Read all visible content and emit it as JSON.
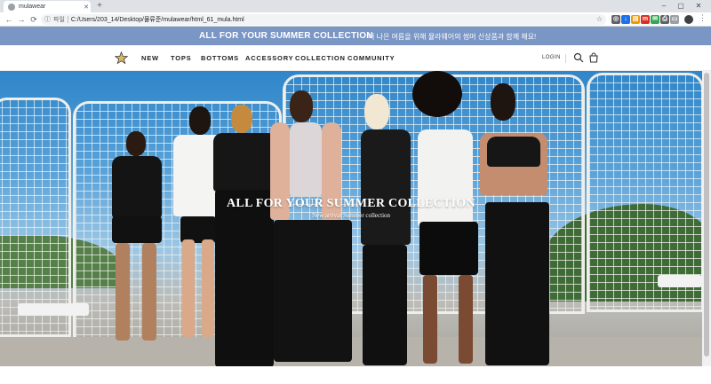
{
  "browser": {
    "tab_title": "mulawear",
    "new_tab": "+",
    "scheme_label": "파일",
    "url": "C:/Users/203_14/Desktop/물류준/mulawear/html_61_mula.html",
    "window_controls": {
      "minimize": "–",
      "maximize": "▢",
      "close": "✕"
    },
    "nav": {
      "back": "←",
      "forward": "→",
      "reload": "⟳"
    },
    "extensions": [
      {
        "name": "camera-ext-icon",
        "color": "#5f6368",
        "glyph": "◎"
      },
      {
        "name": "download-ext-icon",
        "color": "#1a73e8",
        "glyph": "↓"
      },
      {
        "name": "lock-ext-icon",
        "color": "#f29900",
        "glyph": "▤"
      },
      {
        "name": "m-ext-icon",
        "color": "#d93025",
        "glyph": "m"
      },
      {
        "name": "gmail-ext-icon",
        "color": "#34a853",
        "glyph": "✉"
      },
      {
        "name": "print-ext-icon",
        "color": "#5f6368",
        "glyph": "⎙"
      },
      {
        "name": "doc-ext-icon",
        "color": "#9aa0a6",
        "glyph": "▭"
      }
    ]
  },
  "promo": {
    "text_en": "ALL FOR YOUR SUMMER COLLECTION",
    "text_ko": "더 나은 여름을 위해 뮬라웨어의 썸머 신상품과 함께 해요!",
    "bg_color": "#7a96c4"
  },
  "nav": {
    "items": [
      "NEW",
      "TOPS",
      "BOTTOMS",
      "ACCESSORY",
      "COLLECTION",
      "COMMUNITY"
    ],
    "login": "LOGIN"
  },
  "hero": {
    "title": "ALL FOR YOUR SUMMER COLLECTION",
    "subtitle": "New arrival Summer collection"
  }
}
